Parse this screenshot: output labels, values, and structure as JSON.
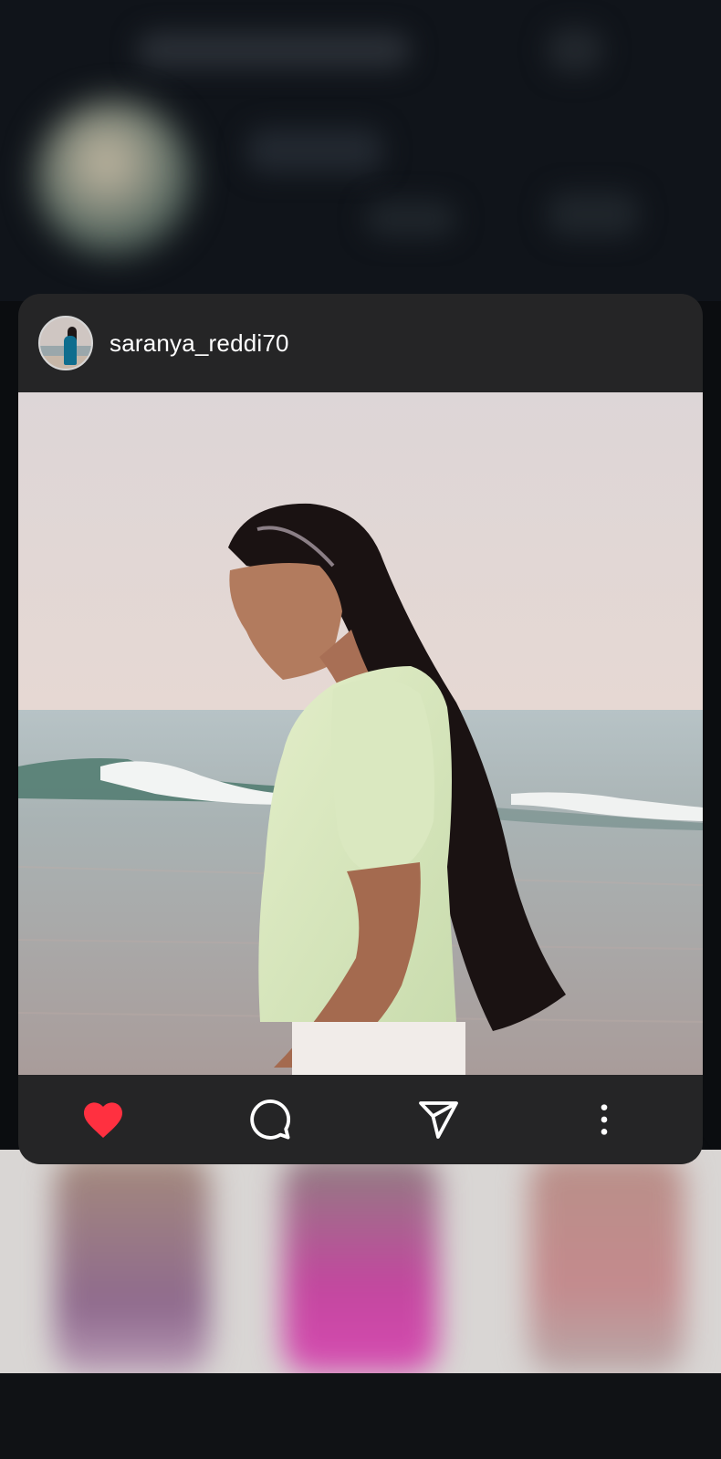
{
  "post": {
    "username": "saranya_reddi70",
    "avatar_icon": "profile-photo",
    "image_icon": "post-photo-woman-at-beach"
  },
  "actions": [
    {
      "name": "like",
      "icon": "heart-icon",
      "state": "liked",
      "color": "#ff3040"
    },
    {
      "name": "comment",
      "icon": "comment-icon"
    },
    {
      "name": "share",
      "icon": "send-icon"
    },
    {
      "name": "more",
      "icon": "more-vertical-icon"
    }
  ],
  "colors": {
    "card_bg": "#252526",
    "like_active": "#ff3040",
    "icon_default": "#ffffff"
  }
}
